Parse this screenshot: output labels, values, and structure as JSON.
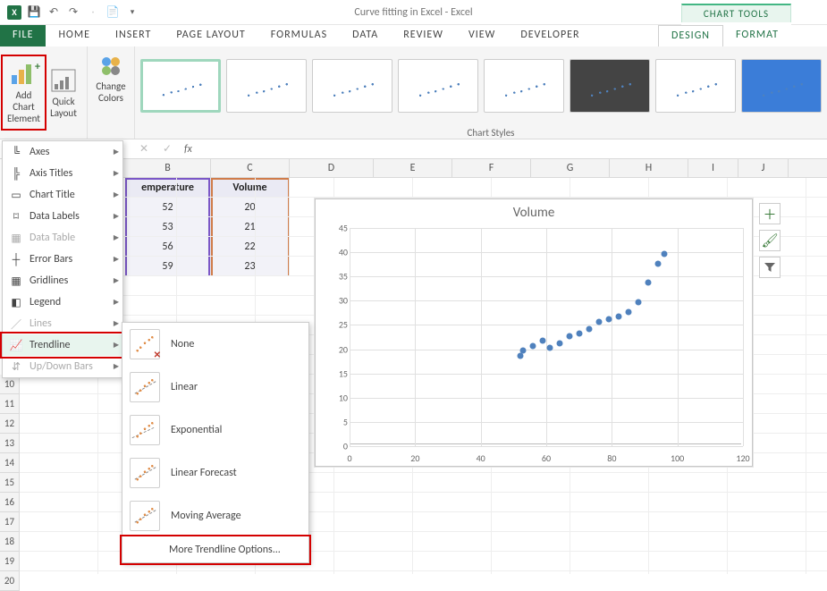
{
  "window": {
    "title": "Curve fitting in Excel - Excel",
    "context_tools": "CHART TOOLS"
  },
  "tabs": {
    "file": "FILE",
    "home": "HOME",
    "insert": "INSERT",
    "page_layout": "PAGE LAYOUT",
    "formulas": "FORMULAS",
    "data": "DATA",
    "review": "REVIEW",
    "view": "VIEW",
    "developer": "DEVELOPER",
    "design": "DESIGN",
    "format": "FORMAT"
  },
  "ribbon": {
    "add_chart_element": "Add Chart\nElement",
    "quick_layout": "Quick\nLayout",
    "change_colors": "Change\nColors",
    "chart_styles_label": "Chart Styles"
  },
  "formula_bar": {
    "fx": "fx"
  },
  "columns": [
    "B",
    "C",
    "D",
    "E",
    "F",
    "G",
    "H",
    "I",
    "J"
  ],
  "rows_visible": [
    "10",
    "11",
    "12",
    "13",
    "14",
    "15",
    "16",
    "17",
    "18",
    "19",
    "20"
  ],
  "table": {
    "headers": {
      "b": "Temperature",
      "b_visible": "emperature",
      "c": "Volume"
    },
    "rows": [
      {
        "b": "52",
        "c": "20"
      },
      {
        "b": "53",
        "c": "21"
      },
      {
        "b": "56",
        "c": "22"
      },
      {
        "b": "59",
        "c": "23"
      }
    ]
  },
  "chart": {
    "title": "Volume",
    "x_ticks": [
      "0",
      "20",
      "40",
      "60",
      "80",
      "100",
      "120"
    ],
    "y_ticks": [
      "0",
      "5",
      "10",
      "15",
      "20",
      "25",
      "30",
      "35",
      "40",
      "45"
    ]
  },
  "chart_data": {
    "type": "scatter",
    "title": "Volume",
    "xlabel": "",
    "ylabel": "",
    "xlim": [
      0,
      120
    ],
    "ylim": [
      0,
      45
    ],
    "series": [
      {
        "name": "Volume",
        "x": [
          52,
          53,
          56,
          59,
          61,
          64,
          67,
          70,
          73,
          76,
          79,
          82,
          85,
          88,
          91,
          94,
          96
        ],
        "y": [
          20,
          21,
          22,
          23,
          21.5,
          22.5,
          24,
          24.5,
          25.5,
          27,
          27.5,
          28,
          29,
          31,
          35,
          39,
          41
        ]
      }
    ]
  },
  "add_chart_menu": {
    "axes": "Axes",
    "axis_titles": "Axis Titles",
    "chart_title": "Chart Title",
    "data_labels": "Data Labels",
    "data_table": "Data Table",
    "error_bars": "Error Bars",
    "gridlines": "Gridlines",
    "legend": "Legend",
    "lines": "Lines",
    "trendline": "Trendline",
    "updown": "Up/Down Bars"
  },
  "trendline_menu": {
    "none": "None",
    "linear": "Linear",
    "exponential": "Exponential",
    "linear_forecast": "Linear Forecast",
    "moving_average": "Moving Average",
    "more": "More Trendline Options..."
  }
}
